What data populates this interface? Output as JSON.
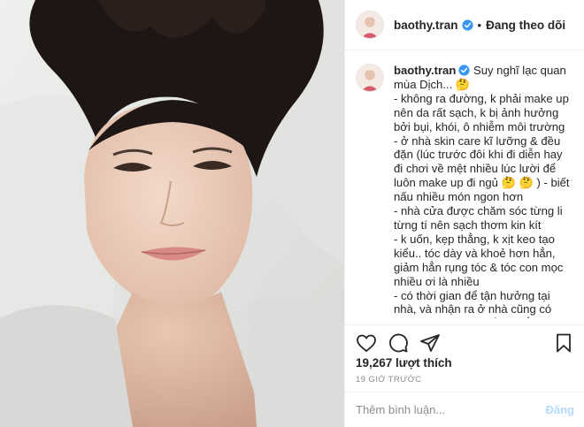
{
  "post": {
    "username": "baothy.tran",
    "follow_label": "Đang theo dõi",
    "separator": "•",
    "caption": "Suy nghĩ lạc quan mùa Dịch... 🤔\n- không ra đường, k phải make up nên da rất sạch, k bị ảnh hưởng bởi bụi, khói, ô nhiễm môi trường\n- ở nhà skin care kĩ lưỡng & đều đặn (lúc trước đôi khi đi diễn hay đi chơi về mệt nhiều lúc lười để luôn make up đi ngủ 🤔 🤔 ) - biết nấu nhiều món ngon hơn\n- nhà cửa được chăm sóc từng li từng tí nên sạch thơm kin kít\n- k uốn, kẹp thẳng, k xịt keo tạo kiểu.. tóc dày và khoẻ hơn hẳn, giảm hẳn rụng tóc & tóc con mọc nhiều ơi là nhiều\n- có thời gian để tận hưởng tại nhà, và nhận ra ở nhà cũng có nhiều thứ hay ho để làm lắm! - siêng tập thể dục hơn\n- được gần gũi Gia đình nhiều hơn\n- DA MỘC ĐẸP ƠI LÀ ĐẸP nhờ ngày nào cũng được ONYX chăm sóc sáng và tối",
    "likes": "19,267 lượt thích",
    "time_ago": "19 GIỜ TRƯỚC",
    "comment_placeholder": "Thêm bình luận...",
    "post_button": "Đăng"
  },
  "icons": {
    "like": "heart-icon",
    "comment": "comment-icon",
    "share": "share-icon",
    "save": "bookmark-icon",
    "verified": "verified-badge-icon"
  },
  "colors": {
    "verified_blue": "#3897f0",
    "post_button_disabled": "#b3dbff",
    "muted_text": "#8e8e8e"
  }
}
